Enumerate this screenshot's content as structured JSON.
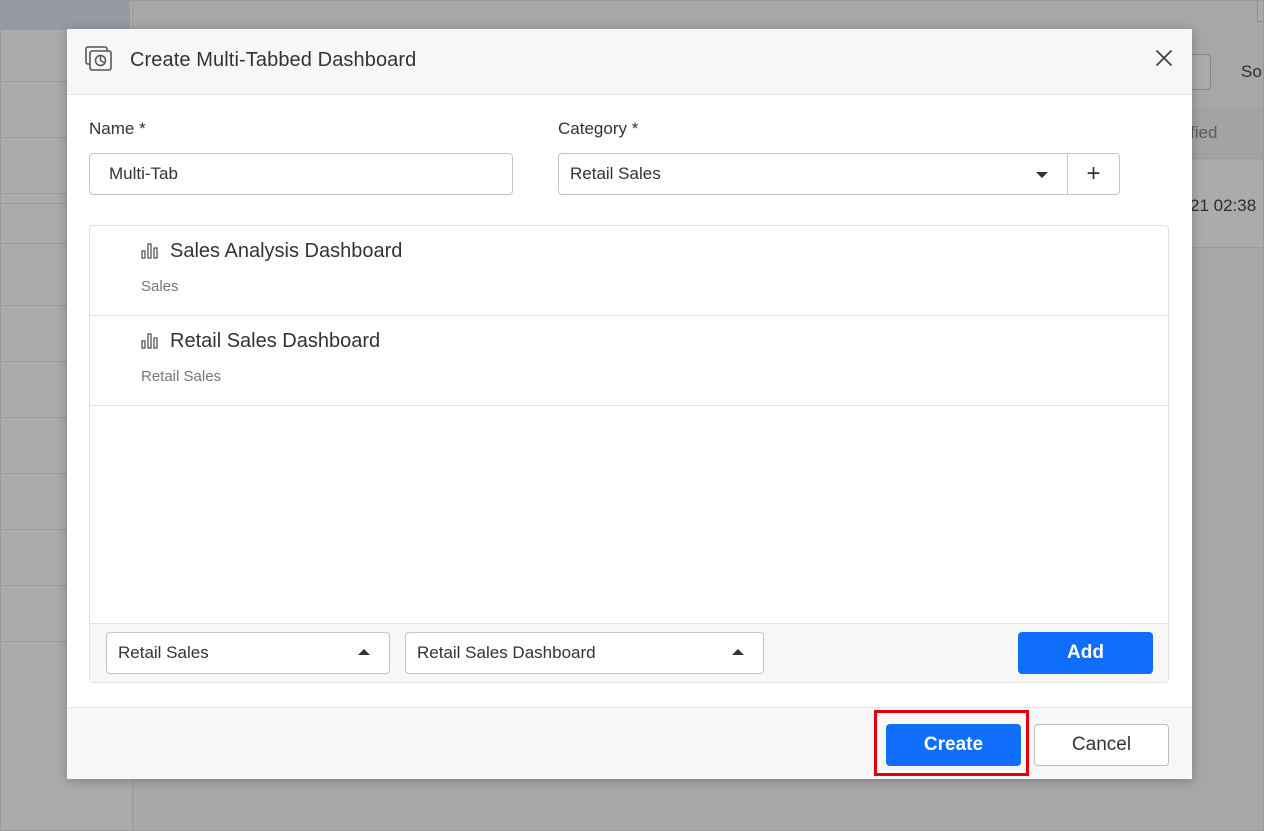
{
  "background": {
    "right_header_partial": "So",
    "column_partial": "fied",
    "row_timestamp_partial": "21 02:38"
  },
  "dialog": {
    "title": "Create Multi-Tabbed Dashboard",
    "header_icon": "dashboard-icon",
    "close_icon": "close-icon",
    "name_label": "Name *",
    "name_value": "Multi-Tab",
    "category_label": "Category *",
    "category_value": "Retail Sales",
    "add_category_symbol": "+",
    "dashboards": [
      {
        "name": "Sales Analysis Dashboard",
        "category": "Sales",
        "icon": "bar-chart-icon"
      },
      {
        "name": "Retail Sales Dashboard",
        "category": "Retail Sales",
        "icon": "bar-chart-icon"
      }
    ],
    "picker_category_value": "Retail Sales",
    "picker_dashboard_value": "Retail Sales Dashboard",
    "add_label": "Add",
    "create_label": "Create",
    "cancel_label": "Cancel",
    "colors": {
      "primary": "#0f6ffc",
      "highlight": "#e00000"
    }
  }
}
